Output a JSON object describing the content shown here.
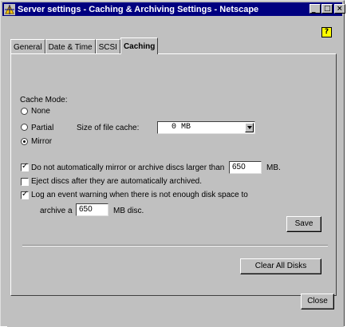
{
  "window": {
    "title": "Server settings - Caching & Archiving Settings - Netscape",
    "app_icon": "netscape-icon"
  },
  "help": {
    "label": "?"
  },
  "tabs": [
    {
      "label": "General",
      "active": false
    },
    {
      "label": "Date & Time",
      "active": false
    },
    {
      "label": "SCSI",
      "active": false
    },
    {
      "label": "Caching",
      "active": true
    }
  ],
  "cache": {
    "mode_label": "Cache Mode:",
    "options": [
      {
        "label": "None",
        "selected": false
      },
      {
        "label": "Partial",
        "selected": false
      },
      {
        "label": "Mirror",
        "selected": true
      }
    ],
    "size_label": "Size of file cache:",
    "size_value": "0 MB"
  },
  "options": {
    "no_mirror": {
      "label": "Do not automatically mirror or archive discs larger than",
      "checked": true,
      "value": "650",
      "unit": "MB."
    },
    "eject": {
      "label": "Eject discs after they are automatically archived.",
      "checked": false
    },
    "log_warning": {
      "label": "Log an event warning when there is not enough disk space to",
      "checked": true
    },
    "archive": {
      "prefix": "archive a",
      "value": "650",
      "unit": "MB disc."
    }
  },
  "buttons": {
    "save": "Save",
    "clear_all": "Clear All Disks",
    "close": "Close"
  }
}
